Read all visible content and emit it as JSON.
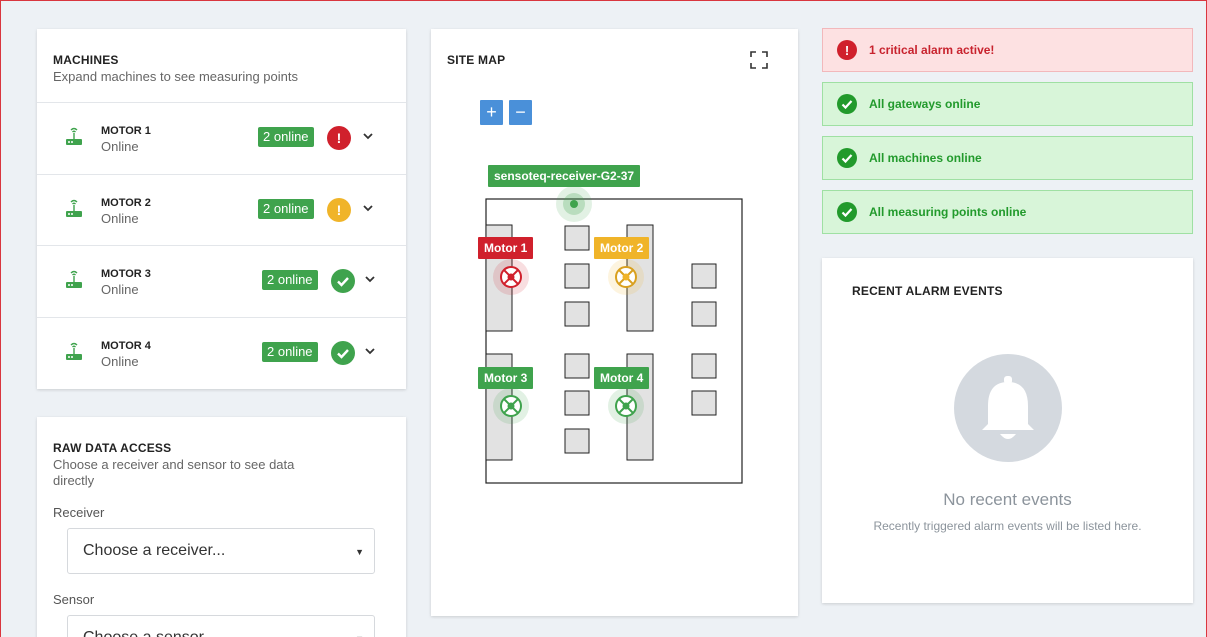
{
  "machines": {
    "title": "MACHINES",
    "subtitle": "Expand machines to see measuring points",
    "items": [
      {
        "name": "MOTOR 1",
        "status": "Online",
        "badge": "2 online",
        "alarm": "critical"
      },
      {
        "name": "MOTOR 2",
        "status": "Online",
        "badge": "2 online",
        "alarm": "warning"
      },
      {
        "name": "MOTOR 3",
        "status": "Online",
        "badge": "2 online",
        "alarm": "ok"
      },
      {
        "name": "MOTOR 4",
        "status": "Online",
        "badge": "2 online",
        "alarm": "ok"
      }
    ]
  },
  "raw": {
    "title": "RAW DATA ACCESS",
    "subtitle": "Choose a receiver and sensor to see data directly",
    "receiver_label": "Receiver",
    "receiver_value": "Choose a receiver...",
    "sensor_label": "Sensor",
    "sensor_value": "Choose a sensor..."
  },
  "sitemap": {
    "title": "SITE MAP",
    "zoom_in": "+",
    "zoom_out": "−",
    "receiver_tag": "sensoteq-receiver-G2-37",
    "motor_tags": [
      "Motor 1",
      "Motor 2",
      "Motor 3",
      "Motor 4"
    ]
  },
  "alerts": {
    "critical": "1 critical alarm active!",
    "gateways": "All gateways online",
    "machines": "All machines online",
    "points": "All measuring points online"
  },
  "alarms": {
    "title": "RECENT ALARM EVENTS",
    "empty_title": "No recent events",
    "empty_sub": "Recently triggered alarm events will be listed here."
  },
  "colors": {
    "ok": "#3fa34d",
    "warning": "#f0b429",
    "critical": "#d0202c",
    "accent": "#4a90d9"
  }
}
